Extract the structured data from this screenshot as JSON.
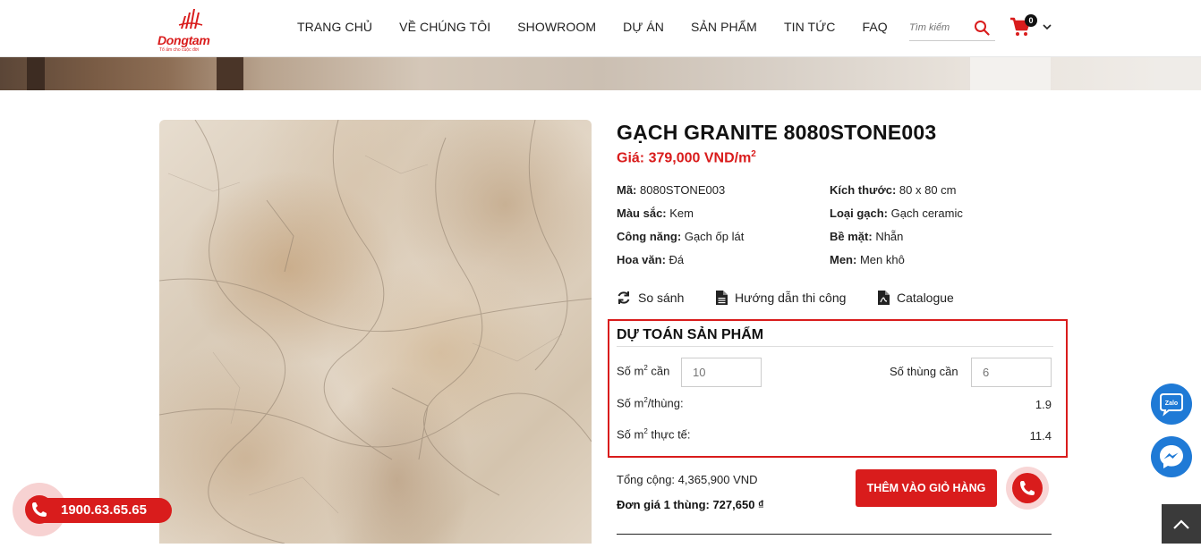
{
  "header": {
    "logo_brand": "Dongtam",
    "logo_tagline": "Tổ ấm cho cuộc đời",
    "nav": [
      "TRANG CHỦ",
      "VỀ CHÚNG TÔI",
      "SHOWROOM",
      "DỰ ÁN",
      "SẢN PHẨM",
      "TIN TỨC",
      "FAQ"
    ],
    "search_placeholder": "Tìm kiếm",
    "cart_count": "0"
  },
  "product": {
    "title": "GẠCH GRANITE 8080STONE003",
    "price_label": "Giá: 379,000 VND/m",
    "price_sup": "2",
    "specs": {
      "code_label": "Mã:",
      "code_value": "8080STONE003",
      "size_label": "Kích thước:",
      "size_value": "80 x 80 cm",
      "color_label": "Màu sắc:",
      "color_value": "Kem",
      "type_label": "Loại gạch:",
      "type_value": "Gạch ceramic",
      "function_label": "Công năng:",
      "function_value": "Gạch ốp lát",
      "surface_label": "Bề mặt:",
      "surface_value": "Nhẵn",
      "pattern_label": "Hoa văn:",
      "pattern_value": "Đá",
      "glaze_label": "Men:",
      "glaze_value": "Men khô"
    },
    "actions": {
      "compare": "So sánh",
      "guide": "Hướng dẫn thi công",
      "catalogue": "Catalogue"
    }
  },
  "estimate": {
    "title": "DỰ TOÁN SẢN PHẨM",
    "m2_need_prefix": "Số m",
    "m2_need_sup": "2",
    "m2_need_suffix": " cần",
    "m2_need_value": "10",
    "boxes_need_label": "Số thùng cần",
    "boxes_need_value": "6",
    "m2_per_box_prefix": "Số m",
    "m2_per_box_sup": "2",
    "m2_per_box_suffix": "/thùng:",
    "m2_per_box_value": "1.9",
    "m2_actual_prefix": "Số m",
    "m2_actual_sup": "2",
    "m2_actual_suffix": " thực tế:",
    "m2_actual_value": "11.4"
  },
  "summary": {
    "total": "Tổng cộng: 4,365,900 VND",
    "unit_price": "Đơn giá 1 thùng: 727,650 ₫",
    "add_to_cart": "THÊM VÀO GIỎ HÀNG"
  },
  "floating": {
    "hotline": "1900.63.65.65",
    "zalo_label": "Zalo"
  },
  "colors": {
    "brand_red": "#d91c1c",
    "float_blue": "#1f7ad6"
  }
}
